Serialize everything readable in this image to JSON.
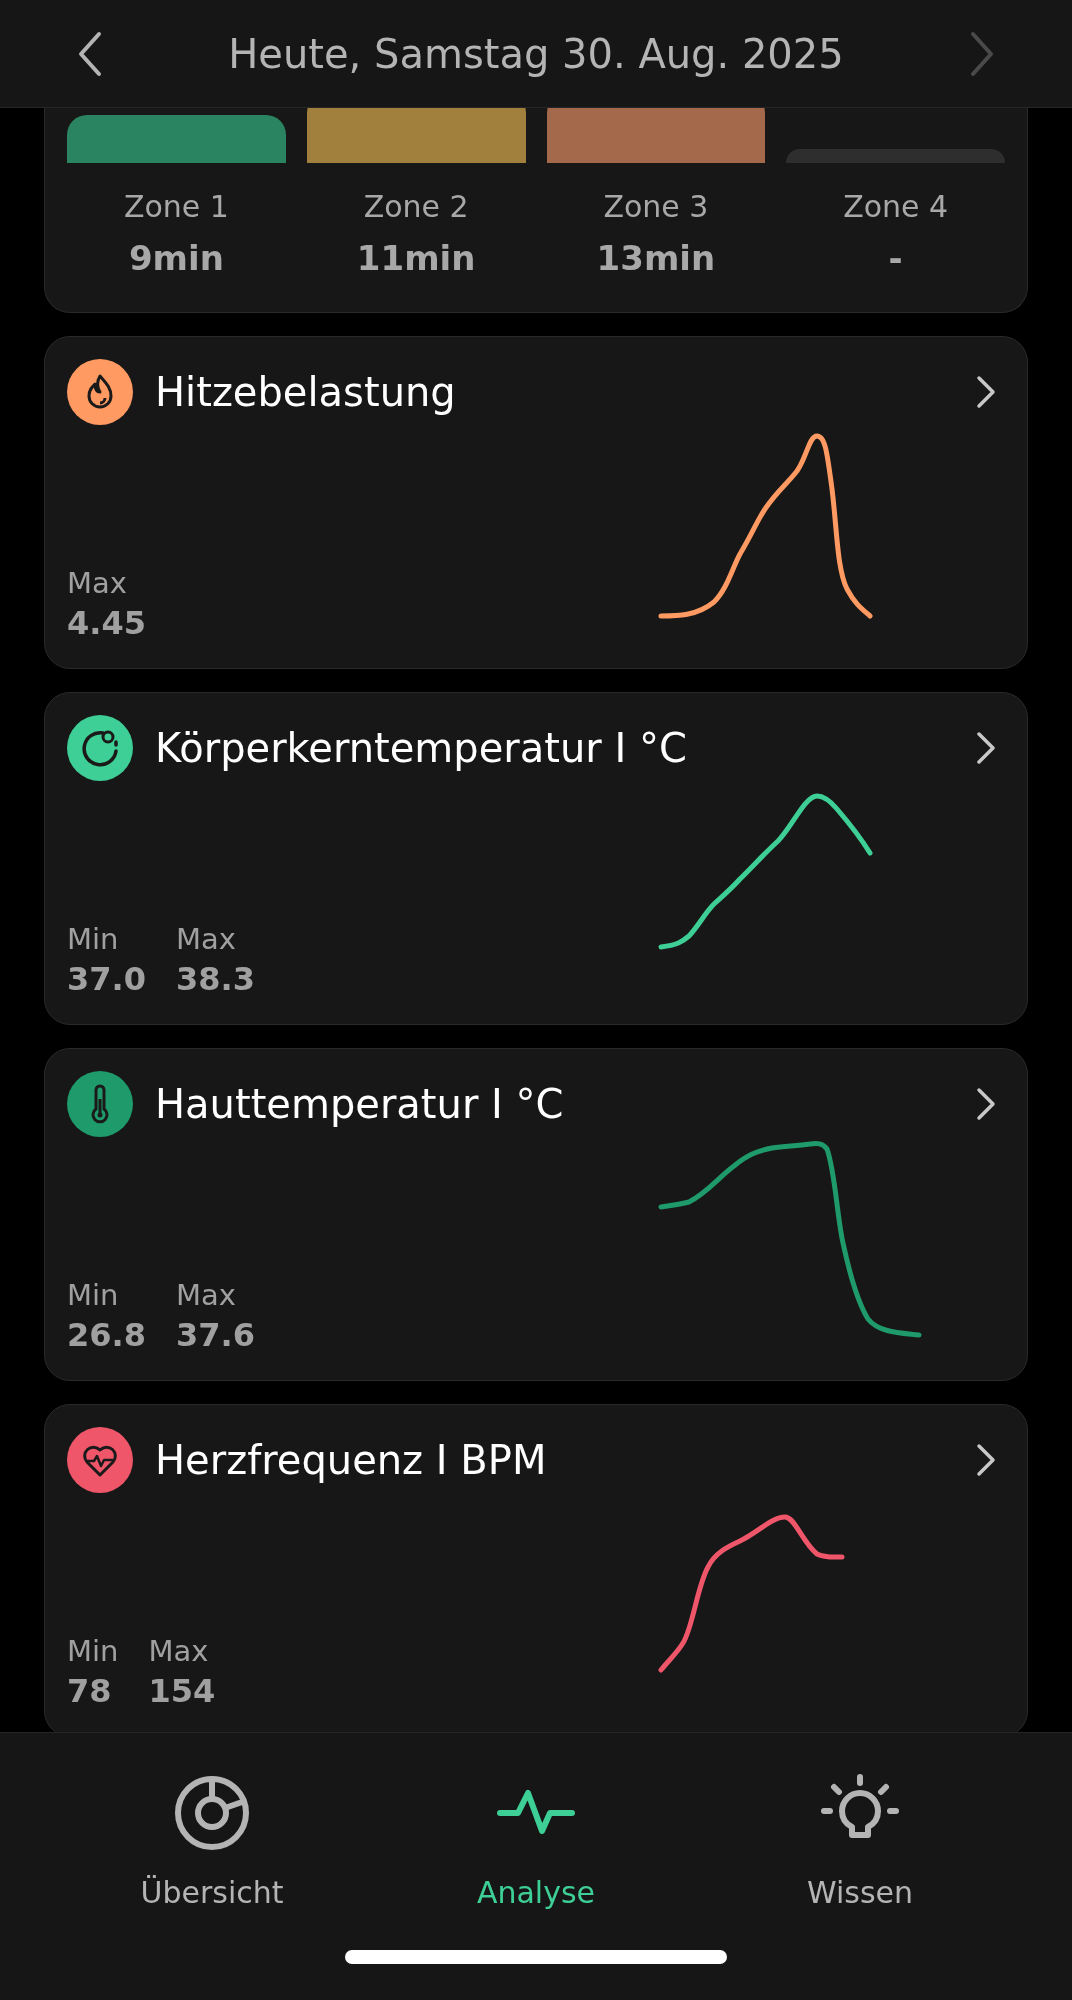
{
  "header": {
    "title": "Heute, Samstag 30. Aug. 2025",
    "buttons": [
      {
        "kind": "prev",
        "disabled": false
      },
      {
        "kind": "next",
        "disabled": true
      }
    ]
  },
  "zones": [
    {
      "label": "Zone 1",
      "value": "9min",
      "color": "#2b8461"
    },
    {
      "label": "Zone 2",
      "value": "11min",
      "color": "#a0803c"
    },
    {
      "label": "Zone 3",
      "value": "13min",
      "color": "#a4684a"
    },
    {
      "label": "Zone 4",
      "value": "-",
      "color": "#2e2e2e"
    }
  ],
  "cards": [
    {
      "kind": "heat",
      "title": "Hitzebelastung",
      "color": "#ff9a62",
      "stats": [
        {
          "label": "Max",
          "value": "4.45"
        }
      ]
    },
    {
      "kind": "core",
      "title": "Körperkerntemperatur I °C",
      "color": "#3dcf95",
      "stats": [
        {
          "label": "Min",
          "value": "37.0"
        },
        {
          "label": "Max",
          "value": "38.3"
        }
      ]
    },
    {
      "kind": "skin",
      "title": "Hauttemperatur I °C",
      "color": "#1f9a6a",
      "stats": [
        {
          "label": "Min",
          "value": "26.8"
        },
        {
          "label": "Max",
          "value": "37.6"
        }
      ]
    },
    {
      "kind": "heart",
      "title": "Herzfrequenz I BPM",
      "color": "#f0566a",
      "stats": [
        {
          "label": "Min",
          "value": "78"
        },
        {
          "label": "Max",
          "value": "154"
        }
      ]
    }
  ],
  "tabs": [
    {
      "kind": "overview",
      "label": "Übersicht",
      "selected": false
    },
    {
      "kind": "analysis",
      "label": "Analyse",
      "selected": true
    },
    {
      "kind": "knowledge",
      "label": "Wissen",
      "selected": false
    }
  ]
}
